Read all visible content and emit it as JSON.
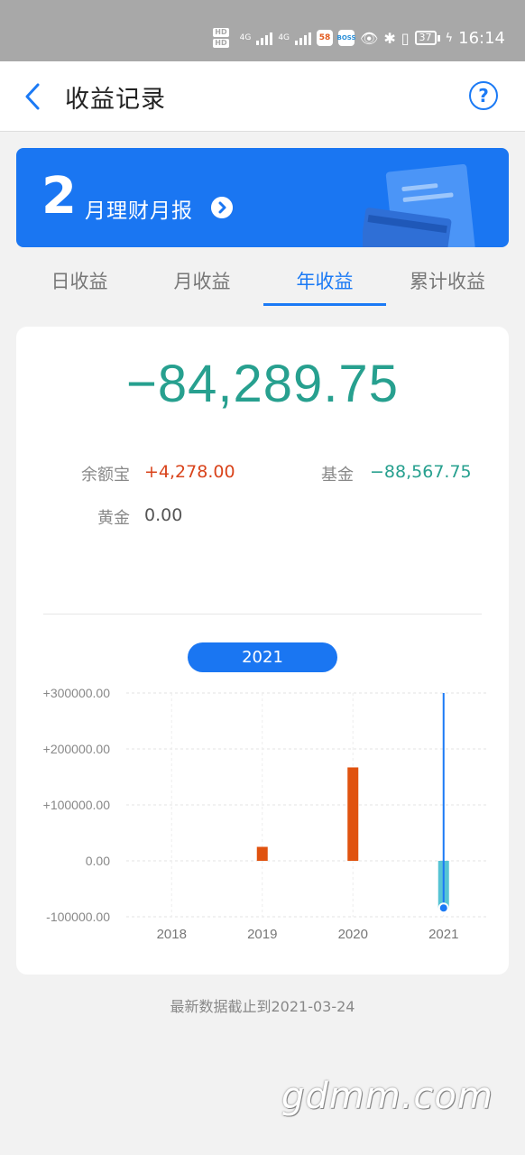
{
  "status_bar": {
    "network_1": "4G",
    "network_2": "4G",
    "app_badge_1": "58",
    "app_badge_2": "BOSS",
    "battery": "37",
    "time": "16:14"
  },
  "nav": {
    "title": "收益记录",
    "help_symbol": "?"
  },
  "banner": {
    "month_number": "2",
    "label": "月理财月报"
  },
  "tabs": [
    {
      "label": "日收益",
      "active": false
    },
    {
      "label": "月收益",
      "active": false
    },
    {
      "label": "年收益",
      "active": true
    },
    {
      "label": "累计收益",
      "active": false
    }
  ],
  "summary": {
    "total": "−84,289.75",
    "items": [
      {
        "label": "余额宝",
        "value": "+4,278.00",
        "color": "#d9441c"
      },
      {
        "label": "基金",
        "value": "−88,567.75",
        "color": "#27a08f"
      },
      {
        "label": "黄金",
        "value": "0.00",
        "color": "#555555"
      }
    ]
  },
  "selected_year": "2021",
  "chart_data": {
    "type": "bar",
    "categories": [
      "2018",
      "2019",
      "2020",
      "2021"
    ],
    "values": [
      0,
      25000,
      167000,
      -84289.75
    ],
    "y_ticks": [
      "+300000.00",
      "+200000.00",
      "+100000.00",
      "0.00",
      "-100000.00"
    ],
    "ylim": [
      -100000,
      300000
    ],
    "grid": true,
    "positive_color": "#e0520f",
    "negative_color": "#56c4d4",
    "highlight_color": "#1b7af5",
    "selected_category": "2021"
  },
  "footnote": "最新数据截止到2021-03-24",
  "watermark": "gdmm.com"
}
